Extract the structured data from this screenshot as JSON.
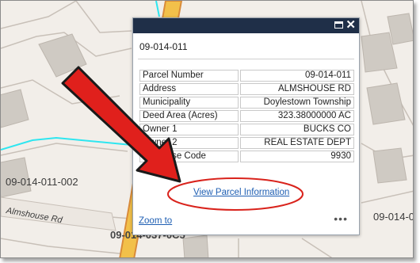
{
  "popup": {
    "title": "09-014-011",
    "attributes": [
      {
        "label": "Parcel Number",
        "value": "09-014-011"
      },
      {
        "label": "Address",
        "value": "ALMSHOUSE RD"
      },
      {
        "label": "Municipality",
        "value": "Doylestown Township"
      },
      {
        "label": "Deed Area (Acres)",
        "value": "323.38000000 AC"
      },
      {
        "label": "Owner 1",
        "value": "BUCKS CO"
      },
      {
        "label": "Owner 2",
        "value": "REAL ESTATE DEPT"
      },
      {
        "label": "Land Use Code",
        "value": "9930"
      }
    ],
    "view_link": "View Parcel Information",
    "zoom_link": "Zoom to",
    "more": "•••"
  },
  "map": {
    "parcel_left": "09-014-011-002",
    "parcel_bottom": "09-014-037-0C5",
    "parcel_right": "09-014-0",
    "road": "Almshouse Rd"
  },
  "colors": {
    "background": "#f2eee9",
    "building": "#cfcac3",
    "parcel_line": "#c8c0b8",
    "highlight_line": "#2ee6f0",
    "road_fill": "#f2c04a",
    "road_edge": "#d98b3a",
    "arrow": "#e0201c",
    "ellipse": "#d9231c",
    "popup_header": "#1f2f48",
    "link": "#1f5fb3"
  }
}
